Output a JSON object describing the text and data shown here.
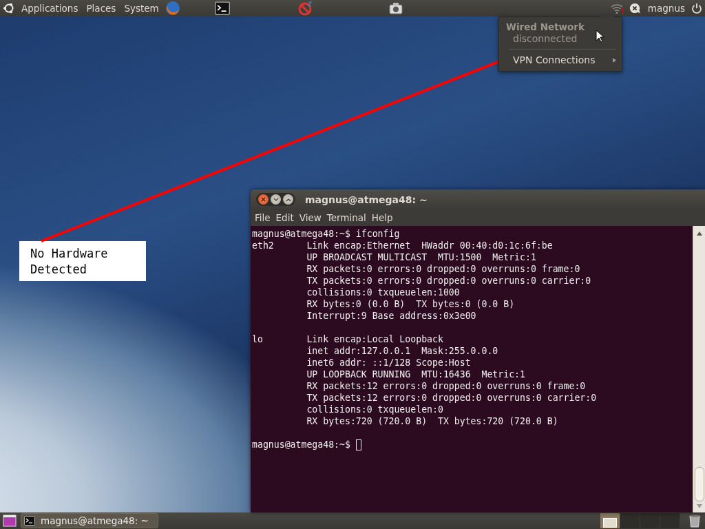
{
  "top_panel": {
    "menus": [
      "Applications",
      "Places",
      "System"
    ],
    "user": "magnus"
  },
  "network_menu": {
    "items": [
      {
        "kind": "header",
        "label": "Wired Network",
        "disabled": true
      },
      {
        "kind": "status",
        "label": "disconnected",
        "disabled": true
      },
      {
        "kind": "separator"
      },
      {
        "kind": "submenu",
        "label": "VPN Connections",
        "disabled": false
      }
    ]
  },
  "annotation": {
    "text": "No Hardware Detected"
  },
  "terminal": {
    "title": "magnus@atmega48: ~",
    "menus": [
      "File",
      "Edit",
      "View",
      "Terminal",
      "Help"
    ],
    "blocks": [
      [
        "magnus@atmega48:~$ ifconfig",
        "eth2      Link encap:Ethernet  HWaddr 00:40:d0:1c:6f:be",
        "          UP BROADCAST MULTICAST  MTU:1500  Metric:1",
        "          RX packets:0 errors:0 dropped:0 overruns:0 frame:0",
        "          TX packets:0 errors:0 dropped:0 overruns:0 carrier:0",
        "          collisions:0 txqueuelen:1000",
        "          RX bytes:0 (0.0 B)  TX bytes:0 (0.0 B)",
        "          Interrupt:9 Base address:0x3e00"
      ],
      [
        "lo        Link encap:Local Loopback",
        "          inet addr:127.0.0.1  Mask:255.0.0.0",
        "          inet6 addr: ::1/128 Scope:Host",
        "          UP LOOPBACK RUNNING  MTU:16436  Metric:1",
        "          RX packets:12 errors:0 dropped:0 overruns:0 frame:0",
        "          TX packets:12 errors:0 dropped:0 overruns:0 carrier:0",
        "          collisions:0 txqueuelen:0",
        "          RX bytes:720 (720.0 B)  TX bytes:720 (720.0 B)"
      ]
    ],
    "prompt": "magnus@atmega48:~$"
  },
  "bottom_panel": {
    "tasks": [
      {
        "label": "magnus@atmega48: ~"
      }
    ],
    "workspaces": [
      {
        "selected": true
      },
      {
        "selected": false
      },
      {
        "selected": false
      },
      {
        "selected": false
      }
    ]
  }
}
